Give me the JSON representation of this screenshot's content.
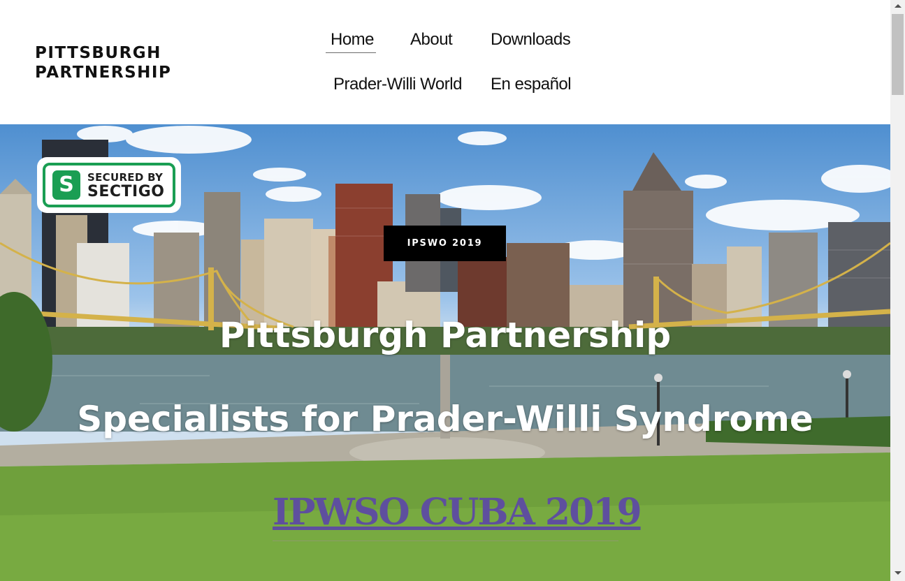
{
  "header": {
    "logo_line1": "PITTSBURGH",
    "logo_line2": "PARTNERSHIP"
  },
  "nav": {
    "home": "Home",
    "about": "About",
    "downloads": "Downloads",
    "prader_willi_world": "Prader-Willi World",
    "en_espanol": "En español"
  },
  "hero": {
    "badge_line1": "SECURED BY",
    "badge_line2": "SECTIGO",
    "badge_icon": "S",
    "tag_button": "IPSWO 2019",
    "title": "Pittsburgh Partnership",
    "subtitle": "Specialists for Prader-Willi Syndrome",
    "event_link": "IPWSO CUBA 2019"
  },
  "colors": {
    "sectigo_green": "#1a9e53",
    "cuba_purple": "#5e4f9e",
    "bridge_yellow": "#d4b24a"
  }
}
